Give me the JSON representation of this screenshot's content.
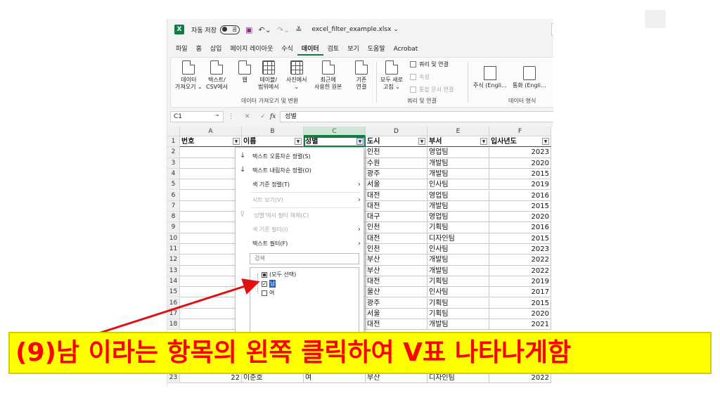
{
  "titlebar": {
    "autosave_label": "자동 저장",
    "autosave_state": "끔",
    "filename": "excel_filter_example.xlsx"
  },
  "menu_tabs": [
    "파일",
    "홈",
    "삽입",
    "페이지 레이아웃",
    "수식",
    "데이터",
    "검토",
    "보기",
    "도움말",
    "Acrobat"
  ],
  "active_tab": "데이터",
  "ribbon": {
    "get_data_group": "데이터 가져오기 및 변환",
    "queries_group": "쿼리 및 연결",
    "data_types_group": "데이터 형식",
    "btn_get_data": [
      "데이터",
      "가져오기 ⌄"
    ],
    "btn_text_csv": [
      "텍스트/",
      "CSV에서"
    ],
    "btn_web": [
      "웹"
    ],
    "btn_table_range": [
      "테이블/",
      "범위에서"
    ],
    "btn_picture": [
      "사진에서",
      "⌄"
    ],
    "btn_recent_sources": [
      "최근에",
      "사용한 원본"
    ],
    "btn_existing": [
      "기존",
      "연결"
    ],
    "btn_refresh_all": [
      "모두 새로",
      "고침 ⌄"
    ],
    "queries_connections": "쿼리 및 연결",
    "properties": "속성",
    "edit_links": "통합 문서 연결",
    "stocks": "주식 (Engli...",
    "currencies": "통화 (Engli..."
  },
  "formula": {
    "namebox": "C1",
    "fx": "fx",
    "value": "성별"
  },
  "columns": [
    "A",
    "B",
    "C",
    "D",
    "E",
    "F"
  ],
  "header_row": [
    "번호",
    "이름",
    "성별",
    "도시",
    "부서",
    "입사년도"
  ],
  "rows_visible": [
    {
      "row": 2,
      "city": "인천",
      "dept": "영업팀",
      "year": "2023"
    },
    {
      "row": 3,
      "city": "수원",
      "dept": "개발팀",
      "year": "2020"
    },
    {
      "row": 4,
      "city": "광주",
      "dept": "개발팀",
      "year": "2015"
    },
    {
      "row": 5,
      "city": "서울",
      "dept": "인사팀",
      "year": "2019"
    },
    {
      "row": 6,
      "city": "대전",
      "dept": "영업팀",
      "year": "2016"
    },
    {
      "row": 7,
      "city": "대전",
      "dept": "개발팀",
      "year": "2015"
    },
    {
      "row": 8,
      "city": "대구",
      "dept": "영업팀",
      "year": "2020"
    },
    {
      "row": 9,
      "city": "인천",
      "dept": "기획팀",
      "year": "2016"
    },
    {
      "row": 10,
      "city": "대전",
      "dept": "디자인팀",
      "year": "2015"
    },
    {
      "row": 11,
      "city": "인천",
      "dept": "인사팀",
      "year": "2023"
    },
    {
      "row": 12,
      "city": "부산",
      "dept": "개발팀",
      "year": "2022"
    },
    {
      "row": 13,
      "city": "부산",
      "dept": "개발팀",
      "year": "2022"
    },
    {
      "row": 14,
      "city": "대전",
      "dept": "기획팀",
      "year": "2019"
    },
    {
      "row": 15,
      "city": "울산",
      "dept": "인사팀",
      "year": "2017"
    },
    {
      "row": 16,
      "city": "광주",
      "dept": "기획팀",
      "year": "2015"
    },
    {
      "row": 17,
      "city": "서울",
      "dept": "기획팀",
      "year": "2020"
    },
    {
      "row": 18,
      "city": "대전",
      "dept": "개발팀",
      "year": "2021"
    }
  ],
  "last_row": {
    "row": "23",
    "no": "22",
    "name": "이준호",
    "gender": "여",
    "city": "부산",
    "dept": "디자인팀",
    "year": "2022"
  },
  "filter_menu": {
    "sort_asc": "텍스트 오름차순 정렬(S)",
    "sort_desc": "텍스트 내림차순 정렬(O)",
    "sort_color": "색 기준 정렬(T)",
    "sheet_view": "시트 보기(V)",
    "clear_filter": "'성별'에서 필터 해제(C)",
    "filter_color": "색 기준 필터(I)",
    "text_filter": "텍스트 필터(F)",
    "search_placeholder": "검색",
    "select_all": "(모두 선택)",
    "option_male": "남",
    "option_female": "여"
  },
  "caption": "(9)남 이라는 항목의 왼쪽 클릭하여 V표 나타나게함",
  "colors": {
    "excel_green": "#107c41",
    "caption_bg": "#ffff00",
    "caption_text": "#ff0000",
    "arrow": "#e01010"
  }
}
